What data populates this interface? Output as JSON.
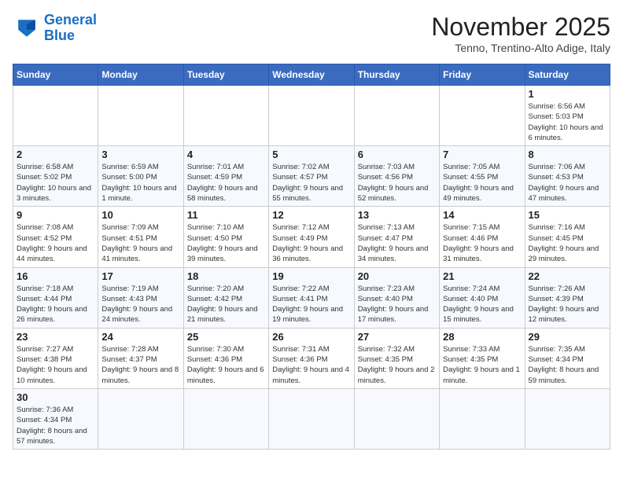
{
  "logo": {
    "line1": "General",
    "line2": "Blue"
  },
  "header": {
    "title": "November 2025",
    "subtitle": "Tenno, Trentino-Alto Adige, Italy"
  },
  "weekdays": [
    "Sunday",
    "Monday",
    "Tuesday",
    "Wednesday",
    "Thursday",
    "Friday",
    "Saturday"
  ],
  "weeks": [
    [
      {
        "day": "",
        "info": ""
      },
      {
        "day": "",
        "info": ""
      },
      {
        "day": "",
        "info": ""
      },
      {
        "day": "",
        "info": ""
      },
      {
        "day": "",
        "info": ""
      },
      {
        "day": "",
        "info": ""
      },
      {
        "day": "1",
        "info": "Sunrise: 6:56 AM\nSunset: 5:03 PM\nDaylight: 10 hours and 6 minutes."
      }
    ],
    [
      {
        "day": "2",
        "info": "Sunrise: 6:58 AM\nSunset: 5:02 PM\nDaylight: 10 hours and 3 minutes."
      },
      {
        "day": "3",
        "info": "Sunrise: 6:59 AM\nSunset: 5:00 PM\nDaylight: 10 hours and 1 minute."
      },
      {
        "day": "4",
        "info": "Sunrise: 7:01 AM\nSunset: 4:59 PM\nDaylight: 9 hours and 58 minutes."
      },
      {
        "day": "5",
        "info": "Sunrise: 7:02 AM\nSunset: 4:57 PM\nDaylight: 9 hours and 55 minutes."
      },
      {
        "day": "6",
        "info": "Sunrise: 7:03 AM\nSunset: 4:56 PM\nDaylight: 9 hours and 52 minutes."
      },
      {
        "day": "7",
        "info": "Sunrise: 7:05 AM\nSunset: 4:55 PM\nDaylight: 9 hours and 49 minutes."
      },
      {
        "day": "8",
        "info": "Sunrise: 7:06 AM\nSunset: 4:53 PM\nDaylight: 9 hours and 47 minutes."
      }
    ],
    [
      {
        "day": "9",
        "info": "Sunrise: 7:08 AM\nSunset: 4:52 PM\nDaylight: 9 hours and 44 minutes."
      },
      {
        "day": "10",
        "info": "Sunrise: 7:09 AM\nSunset: 4:51 PM\nDaylight: 9 hours and 41 minutes."
      },
      {
        "day": "11",
        "info": "Sunrise: 7:10 AM\nSunset: 4:50 PM\nDaylight: 9 hours and 39 minutes."
      },
      {
        "day": "12",
        "info": "Sunrise: 7:12 AM\nSunset: 4:49 PM\nDaylight: 9 hours and 36 minutes."
      },
      {
        "day": "13",
        "info": "Sunrise: 7:13 AM\nSunset: 4:47 PM\nDaylight: 9 hours and 34 minutes."
      },
      {
        "day": "14",
        "info": "Sunrise: 7:15 AM\nSunset: 4:46 PM\nDaylight: 9 hours and 31 minutes."
      },
      {
        "day": "15",
        "info": "Sunrise: 7:16 AM\nSunset: 4:45 PM\nDaylight: 9 hours and 29 minutes."
      }
    ],
    [
      {
        "day": "16",
        "info": "Sunrise: 7:18 AM\nSunset: 4:44 PM\nDaylight: 9 hours and 26 minutes."
      },
      {
        "day": "17",
        "info": "Sunrise: 7:19 AM\nSunset: 4:43 PM\nDaylight: 9 hours and 24 minutes."
      },
      {
        "day": "18",
        "info": "Sunrise: 7:20 AM\nSunset: 4:42 PM\nDaylight: 9 hours and 21 minutes."
      },
      {
        "day": "19",
        "info": "Sunrise: 7:22 AM\nSunset: 4:41 PM\nDaylight: 9 hours and 19 minutes."
      },
      {
        "day": "20",
        "info": "Sunrise: 7:23 AM\nSunset: 4:40 PM\nDaylight: 9 hours and 17 minutes."
      },
      {
        "day": "21",
        "info": "Sunrise: 7:24 AM\nSunset: 4:40 PM\nDaylight: 9 hours and 15 minutes."
      },
      {
        "day": "22",
        "info": "Sunrise: 7:26 AM\nSunset: 4:39 PM\nDaylight: 9 hours and 12 minutes."
      }
    ],
    [
      {
        "day": "23",
        "info": "Sunrise: 7:27 AM\nSunset: 4:38 PM\nDaylight: 9 hours and 10 minutes."
      },
      {
        "day": "24",
        "info": "Sunrise: 7:28 AM\nSunset: 4:37 PM\nDaylight: 9 hours and 8 minutes."
      },
      {
        "day": "25",
        "info": "Sunrise: 7:30 AM\nSunset: 4:36 PM\nDaylight: 9 hours and 6 minutes."
      },
      {
        "day": "26",
        "info": "Sunrise: 7:31 AM\nSunset: 4:36 PM\nDaylight: 9 hours and 4 minutes."
      },
      {
        "day": "27",
        "info": "Sunrise: 7:32 AM\nSunset: 4:35 PM\nDaylight: 9 hours and 2 minutes."
      },
      {
        "day": "28",
        "info": "Sunrise: 7:33 AM\nSunset: 4:35 PM\nDaylight: 9 hours and 1 minute."
      },
      {
        "day": "29",
        "info": "Sunrise: 7:35 AM\nSunset: 4:34 PM\nDaylight: 8 hours and 59 minutes."
      }
    ],
    [
      {
        "day": "30",
        "info": "Sunrise: 7:36 AM\nSunset: 4:34 PM\nDaylight: 8 hours and 57 minutes."
      },
      {
        "day": "",
        "info": ""
      },
      {
        "day": "",
        "info": ""
      },
      {
        "day": "",
        "info": ""
      },
      {
        "day": "",
        "info": ""
      },
      {
        "day": "",
        "info": ""
      },
      {
        "day": "",
        "info": ""
      }
    ]
  ]
}
